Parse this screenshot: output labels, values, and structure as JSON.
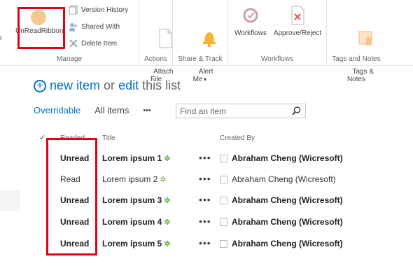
{
  "ribbon": {
    "manage": {
      "alert_label": "lt\nm",
      "unread_label": "UnReadRibbon",
      "version_history": "Version History",
      "shared_with": "Shared With",
      "delete_item": "Delete Item",
      "group_label": "Manage"
    },
    "actions": {
      "attach_file": "Attach\nFile",
      "group_label": "Actions"
    },
    "share_track": {
      "alert_me": "Alert\nMe",
      "group_label": "Share & Track"
    },
    "workflows": {
      "workflows": "Workflows",
      "approve_reject": "Approve/Reject",
      "group_label": "Workflows"
    },
    "tags_notes": {
      "tags_notes": "Tags &\nNotes",
      "group_label": "Tags and Notes"
    }
  },
  "commandbar": {
    "new_item": "new item",
    "or": "or",
    "edit": "edit",
    "this_list": "this list"
  },
  "views": {
    "current": "Overridable",
    "all_items": "All items",
    "more": "•••"
  },
  "search": {
    "placeholder": "Find an item"
  },
  "columns": {
    "readed": "Readed",
    "title": "Title",
    "created_by": "Created By"
  },
  "rows": [
    {
      "read": "Unread",
      "title": "Lorem ipsum 1",
      "created_by": "Abraham Cheng (Wicresoft)"
    },
    {
      "read": "Read",
      "title": "Lorem ipsum 2",
      "created_by": "Abraham Cheng (Wicresoft)"
    },
    {
      "read": "Unread",
      "title": "Lorem ipsum 3",
      "created_by": "Abraham Cheng (Wicresoft)"
    },
    {
      "read": "Unread",
      "title": "Lorem ipsum 4",
      "created_by": "Abraham Cheng (Wicresoft)"
    },
    {
      "read": "Unread",
      "title": "Lorem ipsum 5",
      "created_by": "Abraham Cheng (Wicresoft)"
    }
  ],
  "colors": {
    "accent": "#0072c6",
    "highlight": "#e0001a",
    "unread_icon": "#f8c78e",
    "alert_bell": "#f5b335",
    "new_marker": "#6ab04c"
  },
  "icons": {
    "unread": "circle-icon",
    "version": "version-history-icon",
    "shared": "shared-with-icon",
    "delete": "delete-x-icon",
    "attach": "attach-file-icon",
    "alert": "bell-icon",
    "workflows": "workflows-icon",
    "approve": "approve-reject-icon",
    "tags": "tags-icon",
    "search": "search-icon",
    "new": "new-marker-icon"
  }
}
